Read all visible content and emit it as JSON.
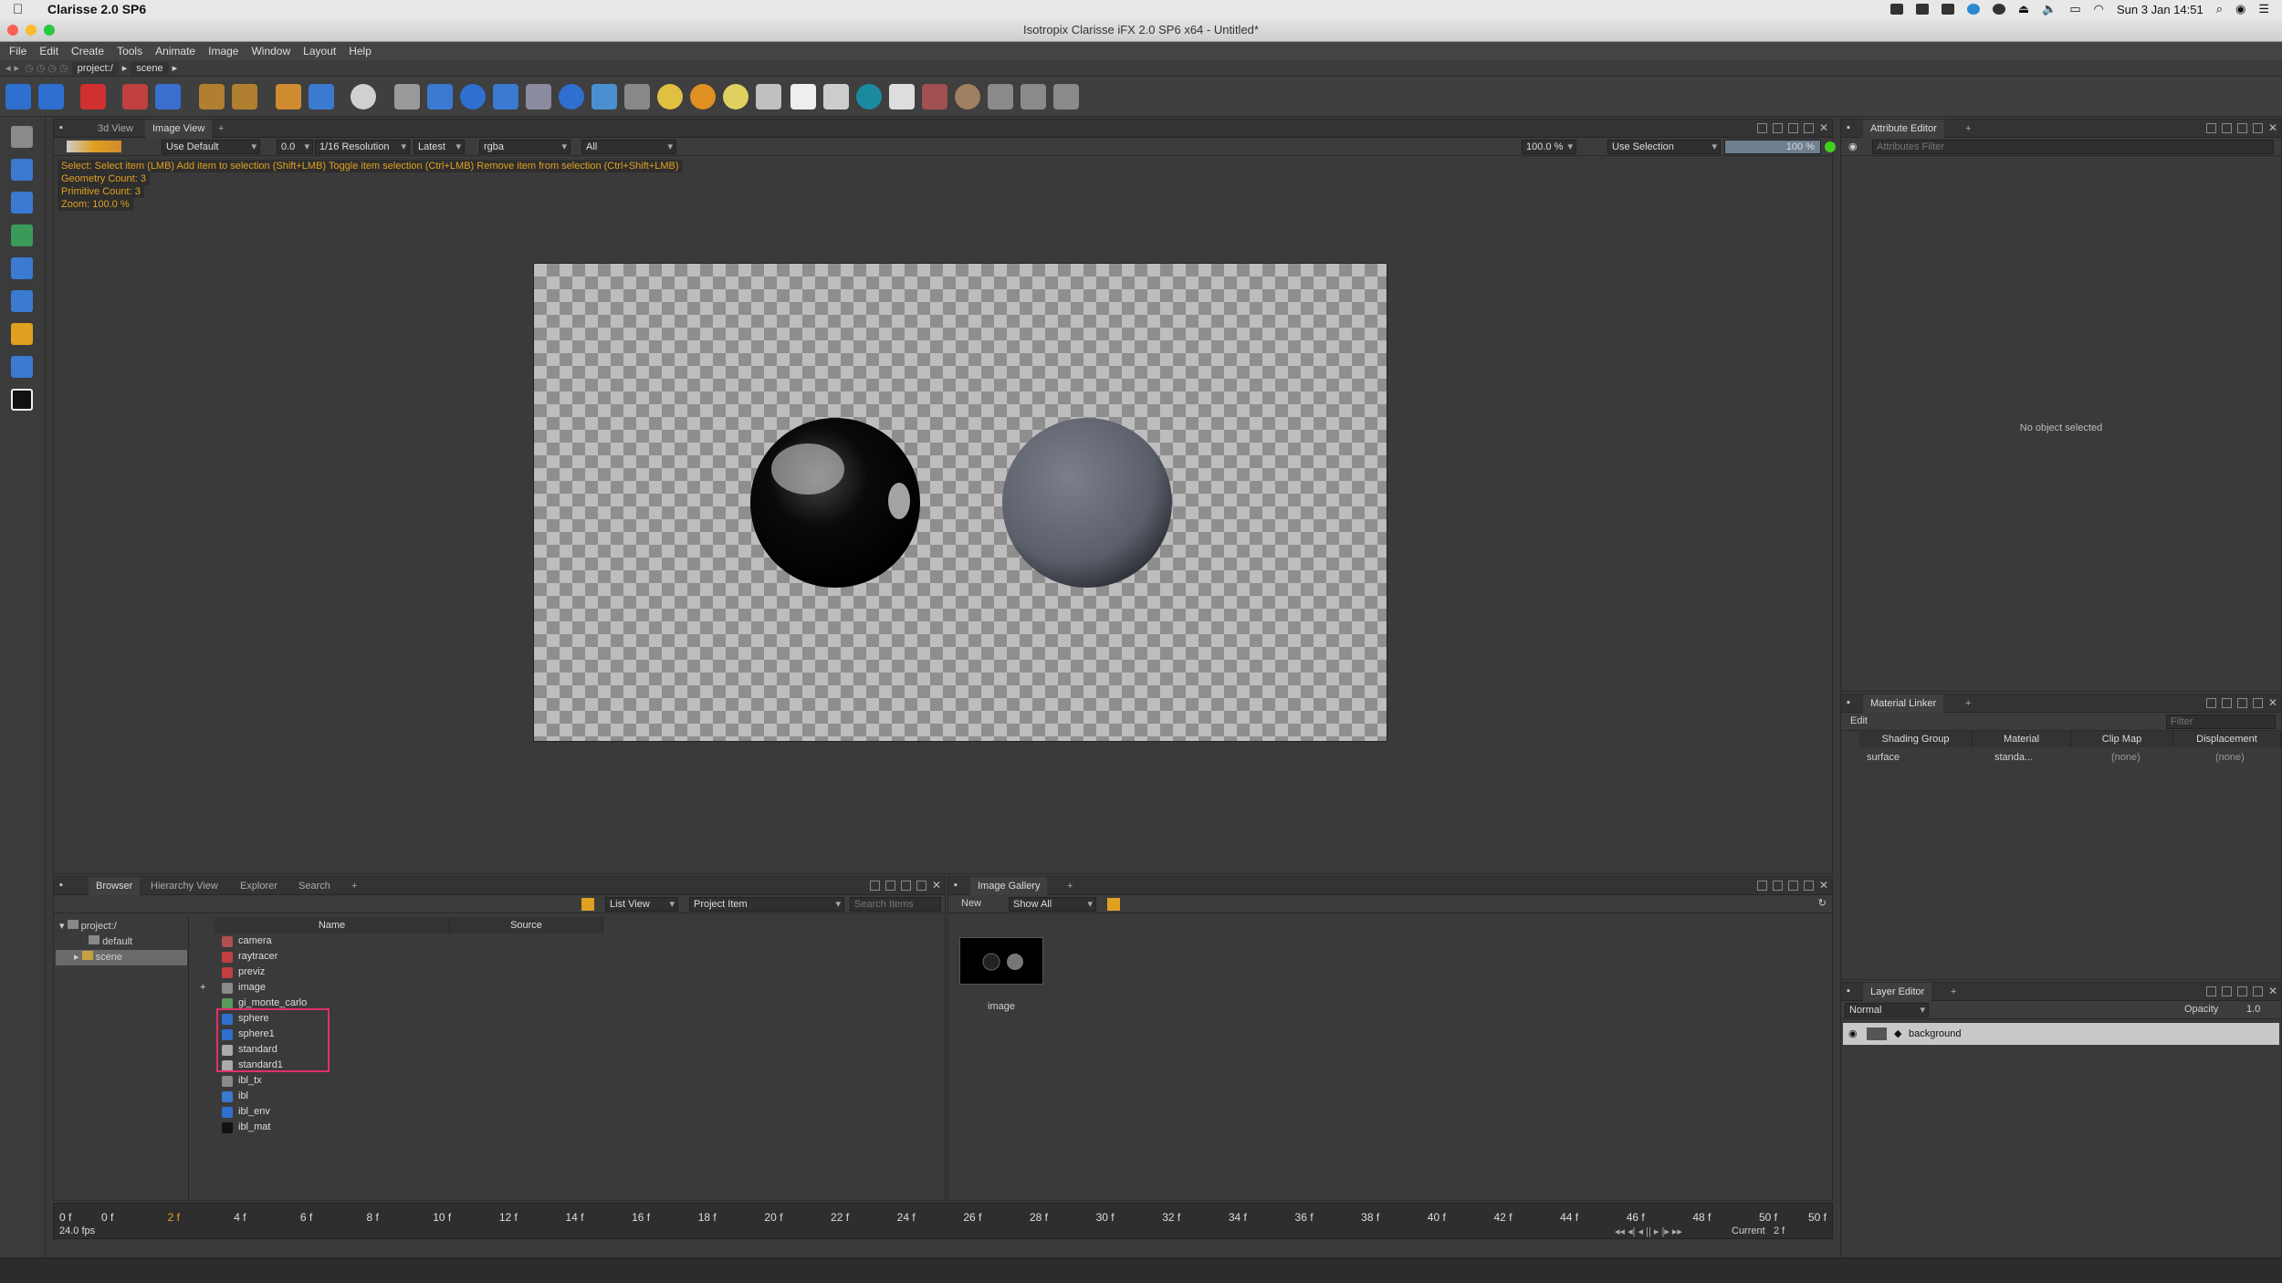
{
  "mac_menubar": {
    "app_name": "Clarisse 2.0 SP6",
    "clock": "Sun 3 Jan  14:51"
  },
  "window_title": "Isotropix Clarisse iFX 2.0 SP6 x64 - Untitled*",
  "menu": [
    "File",
    "Edit",
    "Create",
    "Tools",
    "Animate",
    "Image",
    "Window",
    "Layout",
    "Help"
  ],
  "path": {
    "crumbs": [
      "project:/",
      "scene"
    ]
  },
  "viewport_panel": {
    "tabs": [
      "3d View",
      "Image View"
    ],
    "toolbar": {
      "shading": "Use Default",
      "time": "0.0",
      "resolution": "1/16 Resolution",
      "version": "Latest",
      "channel": "rgba",
      "layer": "All",
      "zoom": "100.0 %",
      "selection": "Use Selection",
      "progress": "100 %"
    },
    "hint": "Select: Select item (LMB)  Add item to selection (Shift+LMB)  Toggle item selection (Ctrl+LMB)  Remove item from selection (Ctrl+Shift+LMB)",
    "geometry_count": "Geometry Count: 3",
    "primitive_count": "Primitive Count: 3",
    "zoom_info": "Zoom: 100.0 %"
  },
  "attribute_editor": {
    "tab": "Attribute Editor",
    "filter_placeholder": "Attributes Filter",
    "empty_text": "No object selected"
  },
  "material_linker": {
    "tab": "Material Linker",
    "edit_label": "Edit",
    "filter_placeholder": "Filter",
    "columns": [
      "Shading Group",
      "Material",
      "Clip Map",
      "Displacement"
    ],
    "rows": [
      {
        "group": "surface",
        "material": "standa...",
        "clip_map": "(none)",
        "displacement": "(none)"
      }
    ]
  },
  "layer_editor": {
    "tab": "Layer Editor",
    "blend_mode": "Normal",
    "opacity_label": "Opacity",
    "opacity_value": "1.0",
    "layers": [
      "background"
    ]
  },
  "browser": {
    "tabs": [
      "Browser",
      "Hierarchy View",
      "Explorer",
      "Search"
    ],
    "view_mode": "List View",
    "filter": "Project Item",
    "search_placeholder": "Search Items",
    "tree": [
      "project:/",
      "default",
      "scene"
    ],
    "columns": [
      "Name",
      "Source"
    ],
    "items": [
      {
        "name": "camera",
        "color": "#b05050"
      },
      {
        "name": "raytracer",
        "color": "#c04040"
      },
      {
        "name": "previz",
        "color": "#c04040"
      },
      {
        "name": "image",
        "color": "#8a8a8a"
      },
      {
        "name": "gi_monte_carlo",
        "color": "#5a9a5a"
      },
      {
        "name": "sphere",
        "color": "#2f6fd0"
      },
      {
        "name": "sphere1",
        "color": "#2f6fd0"
      },
      {
        "name": "standard",
        "color": "#aaaaaa"
      },
      {
        "name": "standard1",
        "color": "#aaaaaa"
      },
      {
        "name": "ibl_tx",
        "color": "#8a8a8a"
      },
      {
        "name": "ibl",
        "color": "#3a7ad0"
      },
      {
        "name": "ibl_env",
        "color": "#2f6fd0"
      },
      {
        "name": "ibl_mat",
        "color": "#111111"
      }
    ]
  },
  "image_gallery": {
    "tab": "Image Gallery",
    "new_label": "New",
    "filter": "Show All",
    "thumbnail_label": "image"
  },
  "timeline": {
    "start": "0 f",
    "end": "50 f",
    "ticks": [
      "0 f",
      "2 f",
      "4 f",
      "6 f",
      "8 f",
      "10 f",
      "12 f",
      "14 f",
      "16 f",
      "18 f",
      "20 f",
      "22 f",
      "24 f",
      "26 f",
      "28 f",
      "30 f",
      "32 f",
      "34 f",
      "36 f",
      "38 f",
      "40 f",
      "42 f",
      "44 f",
      "46 f",
      "48 f",
      "50 f"
    ],
    "fps": "24.0 fps",
    "current_label": "Current",
    "current_value": "2 f"
  },
  "colors": {
    "selection_highlight": "#e0306a",
    "accent_orange": "#e0a020"
  }
}
